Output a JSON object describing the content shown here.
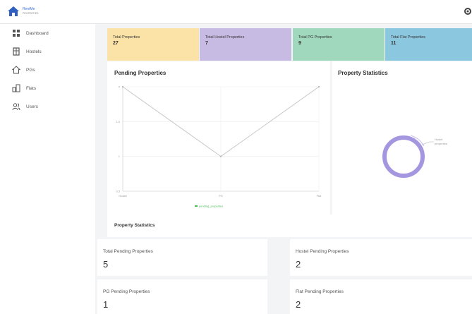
{
  "brand": {
    "name": "RentMe",
    "tagline": "PROPERTIES"
  },
  "sidebar": {
    "items": [
      {
        "label": "Dashboard",
        "icon": "dashboard-icon"
      },
      {
        "label": "Hostels",
        "icon": "hostel-icon"
      },
      {
        "label": "PGs",
        "icon": "pg-icon"
      },
      {
        "label": "Flats",
        "icon": "flats-icon"
      },
      {
        "label": "Users",
        "icon": "users-icon"
      }
    ]
  },
  "summary_cards": [
    {
      "label": "Total Properties",
      "value": "27",
      "color": "#fbe3a8"
    },
    {
      "label": "Total Hostel Properties",
      "value": "7",
      "color": "#c8bbe3"
    },
    {
      "label": "Total PG Properties",
      "value": "9",
      "color": "#9fd8bd"
    },
    {
      "label": "Total Flat Properties",
      "value": "11",
      "color": "#8cc7e0"
    }
  ],
  "pending_chart": {
    "title": "Pending Properties",
    "legend": "pending_properties",
    "line_color": "#c8c8c8",
    "legend_color": "#4cbb5a"
  },
  "property_stats_chart": {
    "title": "Property Statistics",
    "label": "Hostel",
    "sublabel": "properties",
    "ring_color": "#a596e0"
  },
  "chart_data": [
    {
      "type": "line",
      "title": "Pending Properties",
      "categories": [
        "Hostel",
        "PG",
        "Flat"
      ],
      "series": [
        {
          "name": "pending_properties",
          "values": [
            2,
            1,
            2
          ]
        }
      ],
      "ylim": [
        0.5,
        2
      ],
      "yticks": [
        "2",
        "1.5",
        "1",
        "0.5"
      ],
      "grid": true,
      "legend": "bottom"
    }
  ],
  "stats_section": {
    "title": "Property Statistics",
    "boxes": [
      {
        "label": "Total Pending Properties",
        "value": "5"
      },
      {
        "label": "Hostel Pending Properties",
        "value": "2"
      },
      {
        "label": "PG Pending Properties",
        "value": "1"
      },
      {
        "label": "Flat Pending Properties",
        "value": "2"
      }
    ]
  }
}
